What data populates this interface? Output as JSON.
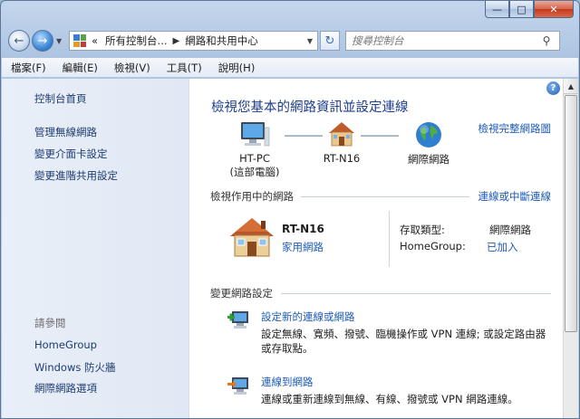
{
  "search": {
    "placeholder": "搜尋控制台"
  },
  "address": {
    "overflow": "«",
    "crumbs": [
      "所有控制台...",
      "網路和共用中心"
    ]
  },
  "menu": [
    "檔案(F)",
    "編輯(E)",
    "檢視(V)",
    "工具(T)",
    "說明(H)"
  ],
  "sidebar": {
    "home": "控制台首頁",
    "links": [
      "管理無線網路",
      "變更介面卡設定",
      "變更進階共用設定"
    ],
    "see_also_label": "請參閱",
    "see_also": [
      "HomeGroup",
      "Windows 防火牆",
      "網際網路選項"
    ]
  },
  "main": {
    "title": "檢視您基本的網路資訊並設定連線",
    "full_map_link": "檢視完整網路圖",
    "nodes": [
      {
        "name": "HT-PC",
        "sub": "(這部電腦)"
      },
      {
        "name": "RT-N16",
        "sub": ""
      },
      {
        "name": "網際網路",
        "sub": ""
      }
    ],
    "active_section": {
      "label": "檢視作用中的網路",
      "link": "連線或中斷連線"
    },
    "active_network": {
      "name": "RT-N16",
      "type": "家用網路",
      "access_type_label": "存取類型:",
      "access_type_value": "網際網路",
      "homegroup_label": "HomeGroup:",
      "homegroup_value": "已加入"
    },
    "change_section": {
      "label": "變更網路設定"
    },
    "tasks": [
      {
        "title": "設定新的連線或網路",
        "desc": "設定無線、寬頻、撥號、臨機操作或 VPN 連線; 或設定路由器或存取點。"
      },
      {
        "title": "連線到網路",
        "desc": "連線或重新連線到無線、有線、撥號或 VPN 網路連線。"
      }
    ]
  },
  "colors": {
    "link": "#1e5bb8",
    "title": "#1e3e8c",
    "sidebar_bg": "#e4ecf6"
  }
}
